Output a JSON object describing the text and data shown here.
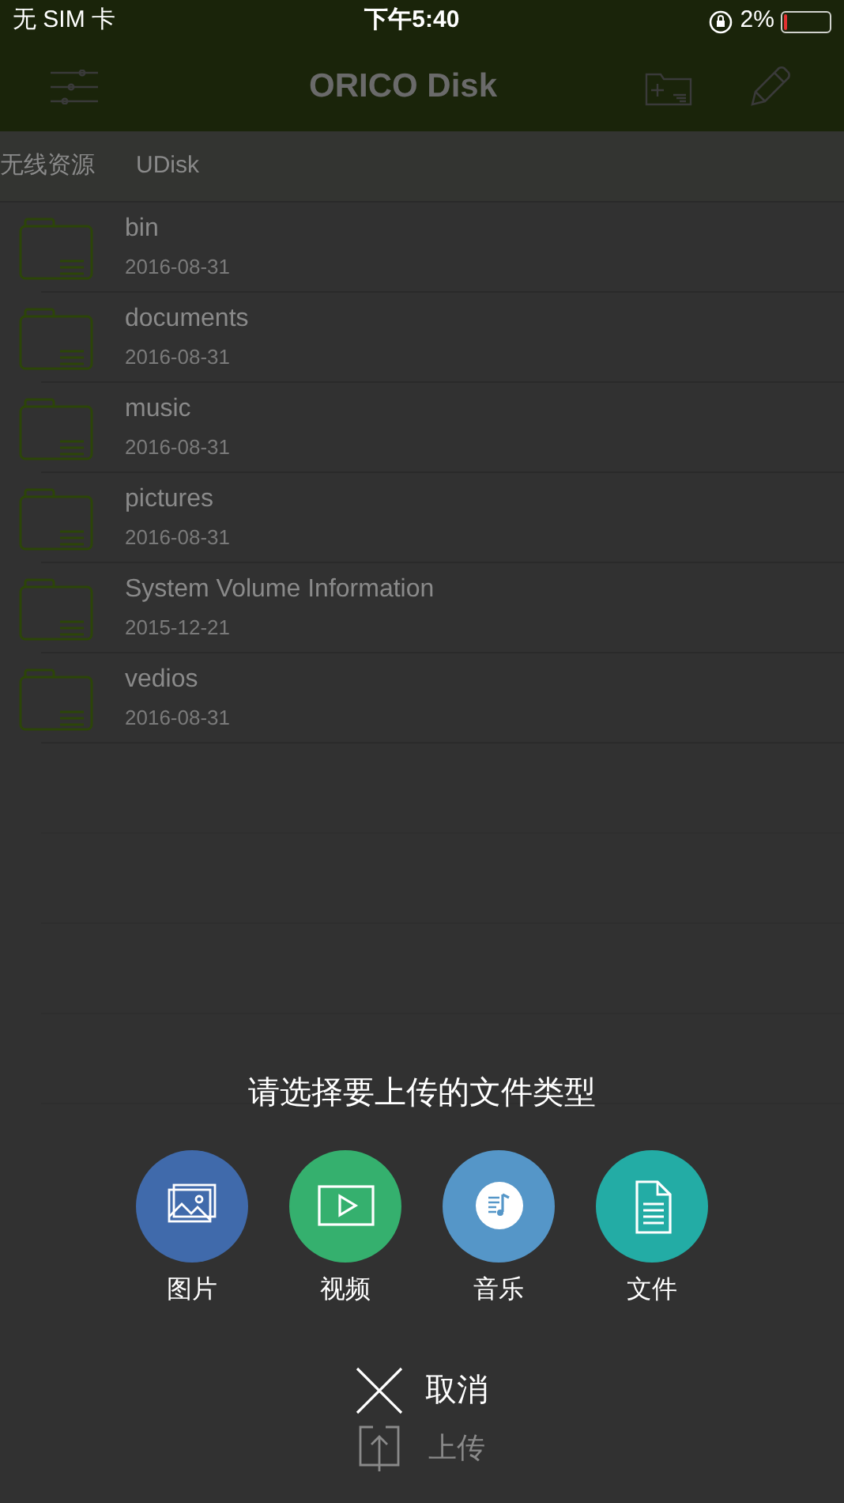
{
  "status_bar": {
    "carrier": "无 SIM 卡",
    "time": "下午5:40",
    "battery": "2%"
  },
  "header": {
    "title": "ORICO Disk"
  },
  "breadcrumb": [
    "无线资源",
    "UDisk"
  ],
  "files": [
    {
      "name": "bin",
      "date": "2016-08-31"
    },
    {
      "name": "documents",
      "date": "2016-08-31"
    },
    {
      "name": "music",
      "date": "2016-08-31"
    },
    {
      "name": "pictures",
      "date": "2016-08-31"
    },
    {
      "name": "System Volume Information",
      "date": "2015-12-21"
    },
    {
      "name": "vedios",
      "date": "2016-08-31"
    }
  ],
  "upload_sheet": {
    "prompt": "请选择要上传的文件类型",
    "options": [
      {
        "label": "图片",
        "kind": "image",
        "color": "#406aab"
      },
      {
        "label": "视频",
        "kind": "video",
        "color": "#35b06e"
      },
      {
        "label": "音乐",
        "kind": "music",
        "color": "#5596c8"
      },
      {
        "label": "文件",
        "kind": "document",
        "color": "#23aca5"
      }
    ],
    "cancel": "取消",
    "upload": "上传"
  }
}
